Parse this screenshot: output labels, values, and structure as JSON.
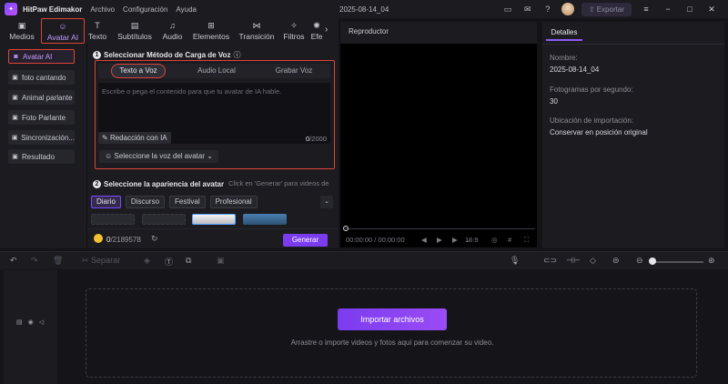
{
  "titlebar": {
    "app_name": "HitPaw Edimakor",
    "menu": [
      "Archivo",
      "Configuración",
      "Ayuda"
    ],
    "project_title": "2025-08-14_04",
    "export_label": "Exportar"
  },
  "tools": [
    {
      "label": "Medios",
      "icon": "media-icon"
    },
    {
      "label": "Avatar AI",
      "icon": "avatar-ai-icon"
    },
    {
      "label": "Texto",
      "icon": "text-icon"
    },
    {
      "label": "Subtítulos",
      "icon": "subtitles-icon"
    },
    {
      "label": "Audio",
      "icon": "audio-icon"
    },
    {
      "label": "Elementos",
      "icon": "elements-icon"
    },
    {
      "label": "Transición",
      "icon": "transition-icon"
    },
    {
      "label": "Filtros",
      "icon": "filters-icon"
    },
    {
      "label": "Efe",
      "icon": "effects-icon"
    }
  ],
  "sidebar": {
    "items": [
      {
        "label": "Avatar AI"
      },
      {
        "label": "foto cantando"
      },
      {
        "label": "Animal parlante"
      },
      {
        "label": "Foto Parlante"
      },
      {
        "label": "Sincronización..."
      },
      {
        "label": "Resultado"
      }
    ]
  },
  "ai_panel": {
    "step1_num": "1",
    "step1_title": "Seleccionar Método de Carga de Voz",
    "voice_tabs": [
      "Texto a Voz",
      "Audio Local",
      "Grabar Voz"
    ],
    "textarea_placeholder": "Escribe o pega el contenido para que tu avatar de IA hable.",
    "redaccion_label": "Redacción con IA",
    "char_count": "0",
    "char_max": "/2000",
    "select_voice_label": "Seleccione la voz del avatar",
    "step2_num": "2",
    "step2_title": "Seleccione la apariencia del avatar",
    "step2_hint": "Click en 'Generar' para videos de",
    "categories": [
      "Diario",
      "Discurso",
      "Festival",
      "Profesional"
    ],
    "credits_current": "0",
    "credits_total": "/2189578",
    "generate_label": "Generar"
  },
  "preview": {
    "title": "Reproductor",
    "time": "00:00:00 / 00:00:00",
    "aspect": "16:9"
  },
  "details": {
    "tab_label": "Detalles",
    "name_label": "Nombre:",
    "name_value": "2025-08-14_04",
    "fps_label": "Fotogramas por segundo:",
    "fps_value": "30",
    "import_loc_label": "Ubicación de importación:",
    "import_loc_value": "Conservar en posición original"
  },
  "edit_toolbar": {
    "split_label": "Separar"
  },
  "timeline": {
    "import_label": "Importar archivos",
    "drop_hint": "Arrastre o importe videos y fotos aquí para comenzar su video."
  },
  "colors": {
    "accent": "#7b3cf0",
    "highlight": "#e0433b",
    "active_text": "#c79bff"
  }
}
